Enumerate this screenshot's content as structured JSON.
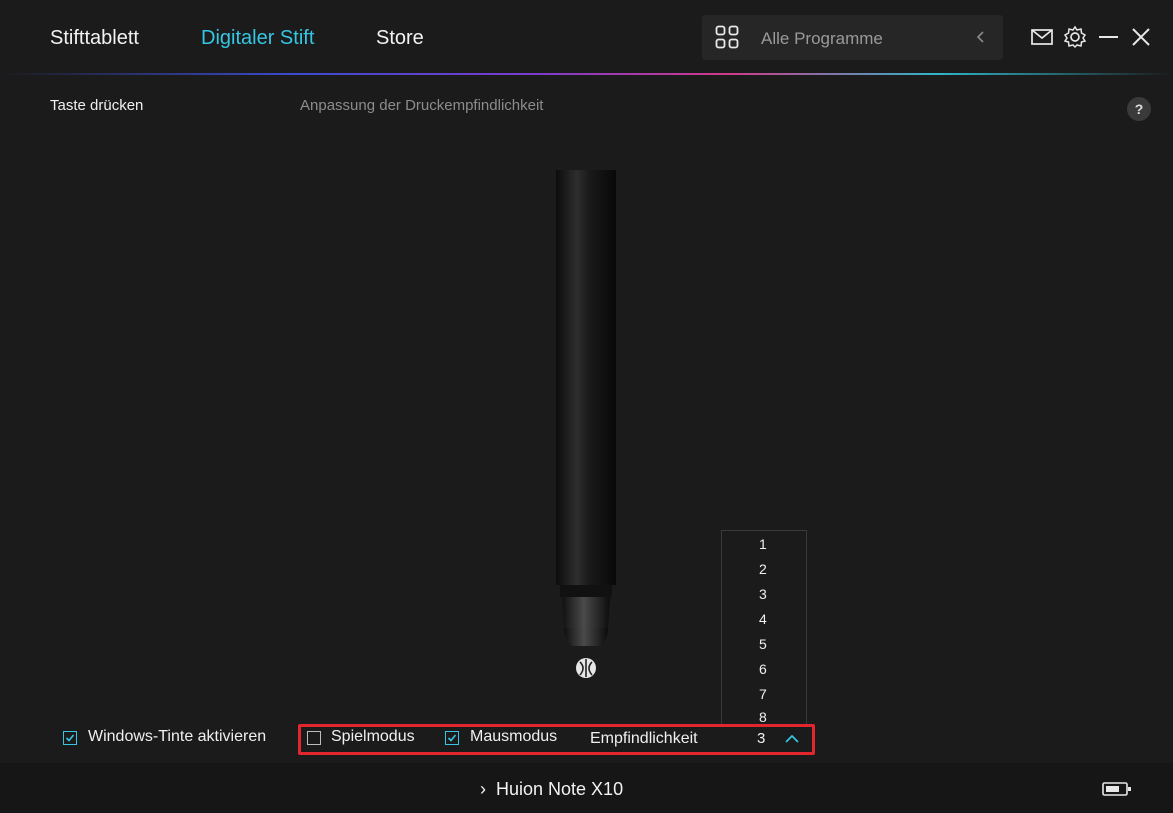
{
  "header": {
    "tabs": [
      {
        "label": "Stifttablett",
        "active": false
      },
      {
        "label": "Digitaler Stift",
        "active": true
      },
      {
        "label": "Store",
        "active": false
      }
    ],
    "program_selector": {
      "label": "Alle Programme"
    },
    "icons": [
      "apps-grid-icon",
      "chevron-left-icon",
      "mail-icon",
      "gear-icon",
      "minimize-icon",
      "close-icon"
    ]
  },
  "subnav": {
    "items": [
      {
        "label": "Taste drücken",
        "active": true
      },
      {
        "label": "Anpassung der Druckempfindlichkeit",
        "active": false
      }
    ],
    "help": "?"
  },
  "options": {
    "windows_ink": {
      "label": "Windows-Tinte aktivieren",
      "checked": true
    },
    "game_mode": {
      "label": "Spielmodus",
      "checked": false
    },
    "mouse_mode": {
      "label": "Mausmodus",
      "checked": true
    },
    "sensitivity": {
      "label": "Empfindlichkeit",
      "value": "3",
      "options": [
        "1",
        "2",
        "3",
        "4",
        "5",
        "6",
        "7",
        "8"
      ]
    }
  },
  "footer": {
    "device_name": "Huion Note X10",
    "chevron": "›"
  },
  "colors": {
    "accent": "#35c6e3",
    "background": "#1b1b1b",
    "highlight": "#e3262b"
  }
}
